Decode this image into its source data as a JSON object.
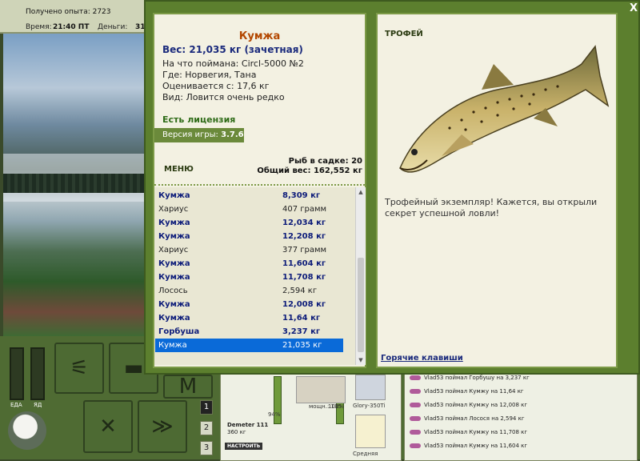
{
  "header": {
    "experience_label": "Получено опыта: 2723",
    "time_label": "Время:",
    "time_value": "21:40 ПТ",
    "money_label": "Деньги:",
    "money_value": "31"
  },
  "gauges": {
    "food_label": "ЕДА",
    "energy_label": "ЯД"
  },
  "slots": [
    "1",
    "2",
    "3"
  ],
  "gear": {
    "rod_name": "Demeter 111",
    "rod_weight": "360 кг",
    "rod_percent": "94%",
    "setup_button": "НАСТРОИТЬ",
    "reel_power": "мощн.: 135",
    "reel_percent": "100%",
    "lure_name": "Glory-350Ti",
    "lure2_name": "Средняя"
  },
  "chat": [
    "Vlad53 поймал Горбушу на 3,237 кг",
    "Vlad53 поймал Кумжу на 11,64 кг",
    "Vlad53 поймал Кумжу на 12,008 кг",
    "Vlad53 поймал Лосося на 2,594 кг",
    "Vlad53 поймал Кумжу на 11,708 кг",
    "Vlad53 поймал Кумжу на 11,604 кг"
  ],
  "modal": {
    "close_label": "X",
    "fish": {
      "name": "Кумжа",
      "weight": "Вес: 21,035 кг (зачетная)",
      "caught_with": "На что поймана: Circl-5000 №2",
      "where": "Где: Норвегия, Тана",
      "valued_from": "Оценивается с: 17,6 кг",
      "kind": "Вид: Ловится очень редко"
    },
    "license": "Есть лицензия",
    "version_label": "Версия игры:",
    "version_value": "3.7.6",
    "menu_label": "МЕНЮ",
    "keep_count": "Рыб в садке: 20",
    "total_weight": "Общий вес: 162,552 кг",
    "catches": [
      {
        "name": "Кумжа",
        "weight": "8,309 кг",
        "style": "big"
      },
      {
        "name": "Хариус",
        "weight": "407 грамм",
        "style": "small"
      },
      {
        "name": "Кумжа",
        "weight": "12,034 кг",
        "style": "big"
      },
      {
        "name": "Кумжа",
        "weight": "12,208 кг",
        "style": "big"
      },
      {
        "name": "Хариус",
        "weight": "377 грамм",
        "style": "small"
      },
      {
        "name": "Кумжа",
        "weight": "11,604 кг",
        "style": "big"
      },
      {
        "name": "Кумжа",
        "weight": "11,708 кг",
        "style": "big"
      },
      {
        "name": "Лосось",
        "weight": "2,594 кг",
        "style": "small"
      },
      {
        "name": "Кумжа",
        "weight": "12,008 кг",
        "style": "big"
      },
      {
        "name": "Кумжа",
        "weight": "11,64 кг",
        "style": "big"
      },
      {
        "name": "Горбуша",
        "weight": "3,237 кг",
        "style": "big"
      },
      {
        "name": "Кумжа",
        "weight": "21,035 кг",
        "style": "sel"
      }
    ],
    "trophy_label": "ТРОФЕЙ",
    "trophy_text": "Трофейный экземпляр! Кажется, вы открыли секрет успешной ловли!",
    "hotkeys_label": "Горячие клавиши"
  }
}
